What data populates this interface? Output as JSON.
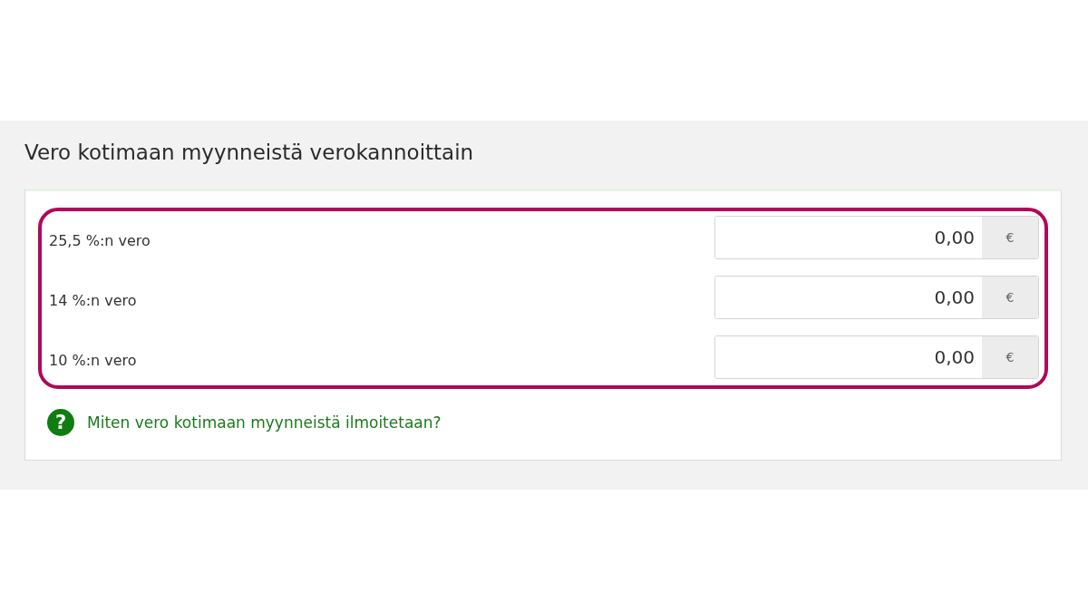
{
  "section": {
    "title": "Vero kotimaan myynneistä verokannoittain"
  },
  "rows": [
    {
      "label": "25,5 %:n vero",
      "value": "0,00",
      "unit": "€"
    },
    {
      "label": "14 %:n vero",
      "value": "0,00",
      "unit": "€"
    },
    {
      "label": "10 %:n vero",
      "value": "0,00",
      "unit": "€"
    }
  ],
  "help": {
    "icon": "?",
    "link": "Miten vero kotimaan myynneistä ilmoitetaan?"
  }
}
